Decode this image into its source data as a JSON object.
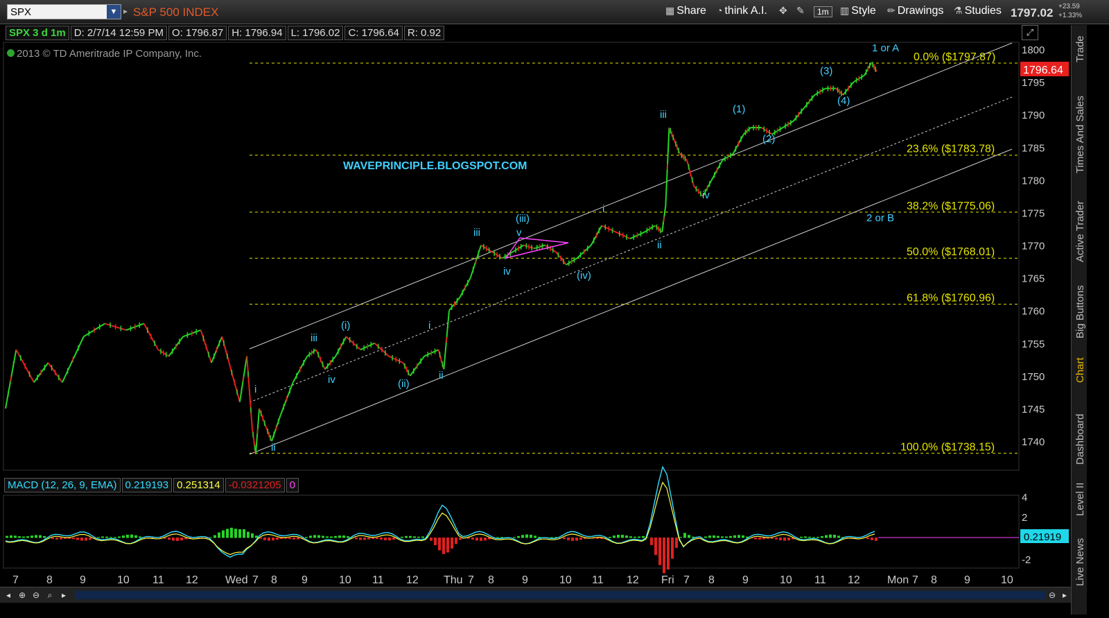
{
  "toolbar": {
    "symbol": "SPX",
    "index_name": "S&P 500 INDEX",
    "share": "Share",
    "think": "think A.I.",
    "interval": "1m",
    "style": "Style",
    "drawings": "Drawings",
    "studies": "Studies",
    "last_price": "1797.02",
    "change": "+23.59",
    "change_pct": "+1.33%"
  },
  "info": {
    "symbol": "SPX 3 d 1m",
    "date": "D: 2/7/14 12:59 PM",
    "open": "O: 1796.87",
    "high": "H: 1796.94",
    "low": "L: 1796.02",
    "close": "C: 1796.64",
    "range": "R: 0.92"
  },
  "copyright": "2013 © TD Ameritrade IP Company, Inc.",
  "side_tabs": [
    "Trade",
    "Times And Sales",
    "Active Trader",
    "Big Buttons",
    "Chart",
    "Dashboard",
    "Level II",
    "Live News"
  ],
  "macd": {
    "label": "MACD (12, 26, 9, EMA)",
    "value": "0.219193",
    "avg": "0.251314",
    "diff": "-0.0321205",
    "zero": "0",
    "current_label": "0.21919"
  },
  "colors": {
    "up": "#26d426",
    "down": "#e02020",
    "fib": "#e6e600",
    "wave": "#3fd0ff",
    "macd_value": "#33ddff",
    "macd_avg": "#ffff44",
    "triangle": "#ff44ff"
  },
  "chart_data": {
    "type": "line",
    "title": "S&P 500 INDEX",
    "ylim": [
      1734,
      1802
    ],
    "y_ticks": [
      1740,
      1745,
      1750,
      1755,
      1760,
      1765,
      1770,
      1775,
      1780,
      1785,
      1790,
      1795,
      1800
    ],
    "x_ticks": [
      "7",
      "8",
      "9",
      "10",
      "11",
      "12",
      "Wed",
      "7",
      "8",
      "9",
      "10",
      "11",
      "12",
      "Thu",
      "7",
      "8",
      "9",
      "10",
      "11",
      "12",
      "Fri",
      "7",
      "8",
      "9",
      "10",
      "11",
      "12",
      "Mon",
      "7",
      "8",
      "9",
      "10"
    ],
    "current_price_label": "1796.64",
    "fib_levels": [
      {
        "label": "0.0%  ($1797.87)",
        "value": 1797.87
      },
      {
        "label": "23.6%  ($1783.78)",
        "value": 1783.78
      },
      {
        "label": "38.2%  ($1775.06)",
        "value": 1775.06
      },
      {
        "label": "50.0%  ($1768.01)",
        "value": 1768.01
      },
      {
        "label": "61.8%  ($1760.96)",
        "value": 1760.96
      },
      {
        "label": "100.0%  ($1738.15)",
        "value": 1738.15
      }
    ],
    "watermark": "WAVEPRINCIPLE.BLOGSPOT.COM",
    "wave_labels": [
      "i",
      "ii",
      "iii",
      "iv",
      "(i)",
      "(ii)",
      "i",
      "ii",
      "iii",
      "iv",
      "v",
      "(iii)",
      "(iv)",
      "i",
      "ii",
      "iii",
      "iv",
      "(1)",
      "(2)",
      "(3)",
      "(4)",
      "1 or A",
      "2 or B"
    ],
    "price_series": [
      {
        "x": 0.0,
        "y": 1745
      },
      {
        "x": 0.3,
        "y": 1754
      },
      {
        "x": 0.8,
        "y": 1749
      },
      {
        "x": 1.2,
        "y": 1752
      },
      {
        "x": 1.6,
        "y": 1749
      },
      {
        "x": 2.2,
        "y": 1756
      },
      {
        "x": 2.8,
        "y": 1758
      },
      {
        "x": 3.4,
        "y": 1757
      },
      {
        "x": 3.9,
        "y": 1758
      },
      {
        "x": 4.3,
        "y": 1754
      },
      {
        "x": 4.6,
        "y": 1753
      },
      {
        "x": 5.0,
        "y": 1756
      },
      {
        "x": 5.5,
        "y": 1757
      },
      {
        "x": 5.8,
        "y": 1752
      },
      {
        "x": 6.1,
        "y": 1756
      },
      {
        "x": 6.3,
        "y": 1752
      },
      {
        "x": 6.6,
        "y": 1746
      },
      {
        "x": 6.8,
        "y": 1753
      },
      {
        "x": 6.95,
        "y": 1742
      },
      {
        "x": 7.05,
        "y": 1738
      },
      {
        "x": 7.15,
        "y": 1745
      },
      {
        "x": 7.35,
        "y": 1742
      },
      {
        "x": 7.5,
        "y": 1740
      },
      {
        "x": 7.75,
        "y": 1744
      },
      {
        "x": 8.1,
        "y": 1749
      },
      {
        "x": 8.5,
        "y": 1753
      },
      {
        "x": 8.75,
        "y": 1754
      },
      {
        "x": 9.0,
        "y": 1751
      },
      {
        "x": 9.3,
        "y": 1753
      },
      {
        "x": 9.6,
        "y": 1756
      },
      {
        "x": 10.0,
        "y": 1754
      },
      {
        "x": 10.4,
        "y": 1755
      },
      {
        "x": 10.8,
        "y": 1753
      },
      {
        "x": 11.2,
        "y": 1752
      },
      {
        "x": 11.4,
        "y": 1750
      },
      {
        "x": 11.8,
        "y": 1753
      },
      {
        "x": 12.2,
        "y": 1754
      },
      {
        "x": 12.35,
        "y": 1751
      },
      {
        "x": 12.5,
        "y": 1760
      },
      {
        "x": 12.8,
        "y": 1762
      },
      {
        "x": 13.1,
        "y": 1765
      },
      {
        "x": 13.4,
        "y": 1770
      },
      {
        "x": 13.7,
        "y": 1769
      },
      {
        "x": 14.0,
        "y": 1768
      },
      {
        "x": 14.3,
        "y": 1769
      },
      {
        "x": 14.6,
        "y": 1770
      },
      {
        "x": 14.9,
        "y": 1769.5
      },
      {
        "x": 15.2,
        "y": 1770
      },
      {
        "x": 15.5,
        "y": 1769
      },
      {
        "x": 15.8,
        "y": 1767
      },
      {
        "x": 16.1,
        "y": 1768
      },
      {
        "x": 16.5,
        "y": 1770
      },
      {
        "x": 16.8,
        "y": 1773
      },
      {
        "x": 17.2,
        "y": 1772
      },
      {
        "x": 17.6,
        "y": 1771
      },
      {
        "x": 18.0,
        "y": 1772
      },
      {
        "x": 18.3,
        "y": 1773
      },
      {
        "x": 18.5,
        "y": 1772
      },
      {
        "x": 18.6,
        "y": 1776
      },
      {
        "x": 18.7,
        "y": 1788
      },
      {
        "x": 18.85,
        "y": 1786
      },
      {
        "x": 19.0,
        "y": 1784
      },
      {
        "x": 19.2,
        "y": 1783
      },
      {
        "x": 19.4,
        "y": 1779
      },
      {
        "x": 19.65,
        "y": 1777.5
      },
      {
        "x": 19.9,
        "y": 1780
      },
      {
        "x": 20.2,
        "y": 1783
      },
      {
        "x": 20.5,
        "y": 1784
      },
      {
        "x": 20.8,
        "y": 1787
      },
      {
        "x": 21.0,
        "y": 1788
      },
      {
        "x": 21.3,
        "y": 1788
      },
      {
        "x": 21.6,
        "y": 1787
      },
      {
        "x": 21.9,
        "y": 1788
      },
      {
        "x": 22.2,
        "y": 1789
      },
      {
        "x": 22.5,
        "y": 1791
      },
      {
        "x": 22.8,
        "y": 1793
      },
      {
        "x": 23.1,
        "y": 1794
      },
      {
        "x": 23.4,
        "y": 1794
      },
      {
        "x": 23.6,
        "y": 1793
      },
      {
        "x": 23.9,
        "y": 1795
      },
      {
        "x": 24.2,
        "y": 1796
      },
      {
        "x": 24.4,
        "y": 1798
      },
      {
        "x": 24.55,
        "y": 1796.6
      }
    ],
    "macd_axis_ticks": [
      "4",
      "2",
      "-2"
    ]
  }
}
